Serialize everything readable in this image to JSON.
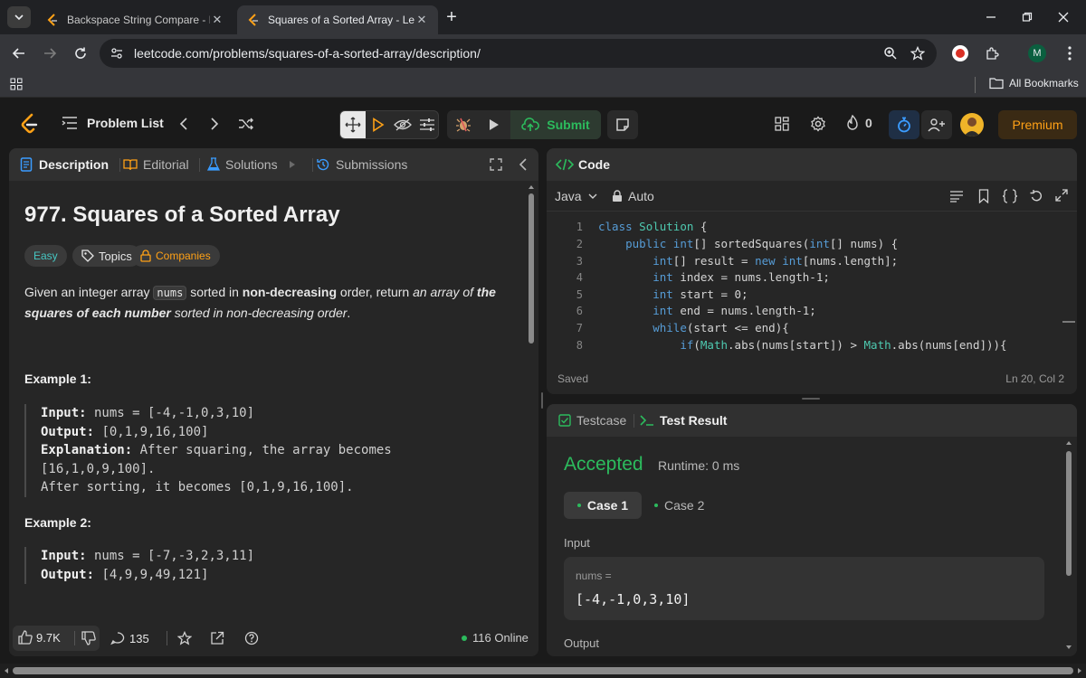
{
  "browser": {
    "tabs": [
      {
        "title": "Backspace String Compare - Lee",
        "active": false
      },
      {
        "title": "Squares of a Sorted Array - Lee",
        "active": true
      }
    ],
    "url": "leetcode.com/problems/squares-of-a-sorted-array/description/",
    "profile_initial": "M",
    "bookmarks_label": "All Bookmarks"
  },
  "nav": {
    "problem_list": "Problem List",
    "submit": "Submit",
    "streak": "0",
    "premium": "Premium"
  },
  "left_tabs": {
    "description": "Description",
    "editorial": "Editorial",
    "solutions": "Solutions",
    "submissions": "Submissions"
  },
  "problem": {
    "title": "977. Squares of a Sorted Array",
    "difficulty": "Easy",
    "topics": "Topics",
    "companies": "Companies",
    "statement": {
      "p1": "Given an integer array ",
      "code": "nums",
      "p2": " sorted in ",
      "bold1": "non-decreasing",
      "p3": " order, return ",
      "ital1": "an array of ",
      "bold2": "the squares of each number",
      "ital2": " sorted in non-decreasing order",
      "p4": "."
    },
    "examples": [
      {
        "heading": "Example 1:",
        "input_label": "Input:",
        "input": " nums = [-4,-1,0,3,10]",
        "output_label": "Output:",
        "output": " [0,1,9,16,100]",
        "explanation_label": "Explanation:",
        "explanation_1": " After squaring, the array becomes",
        "explanation_2": "[16,1,0,9,100].",
        "explanation_3": "After sorting, it becomes [0,1,9,16,100]."
      },
      {
        "heading": "Example 2:",
        "input_label": "Input:",
        "input": " nums = [-7,-3,2,3,11]",
        "output_label": "Output:",
        "output": " [4,9,9,49,121]"
      }
    ],
    "footer": {
      "likes": "9.7K",
      "comments": "135",
      "online": "116 Online"
    }
  },
  "code_panel": {
    "title": "Code",
    "language": "Java",
    "auto": "Auto",
    "status": "Saved",
    "cursor": "Ln 20, Col 2",
    "lines": [
      {
        "n": "1",
        "text": "class Solution {"
      },
      {
        "n": "2",
        "text": "    public int[] sortedSquares(int[] nums) {"
      },
      {
        "n": "3",
        "text": "        int[] result = new int[nums.length];"
      },
      {
        "n": "4",
        "text": "        int index = nums.length-1;"
      },
      {
        "n": "5",
        "text": "        int start = 0;"
      },
      {
        "n": "6",
        "text": "        int end = nums.length-1;"
      },
      {
        "n": "7",
        "text": "        while(start <= end){"
      },
      {
        "n": "8",
        "text": "            if(Math.abs(nums[start]) > Math.abs(nums[end])){"
      }
    ]
  },
  "test_panel": {
    "testcase_tab": "Testcase",
    "result_tab": "Test Result",
    "verdict": "Accepted",
    "runtime": "Runtime: 0 ms",
    "cases": [
      "Case 1",
      "Case 2"
    ],
    "input_label": "Input",
    "var_label": "nums =",
    "var_value": "[-4,-1,0,3,10]",
    "output_label": "Output"
  },
  "colors": {
    "accent_green": "#2cbb5d",
    "premium_orange": "#ffa116",
    "easy_teal": "#46c6c2",
    "timer_blue": "#3b9cff"
  }
}
